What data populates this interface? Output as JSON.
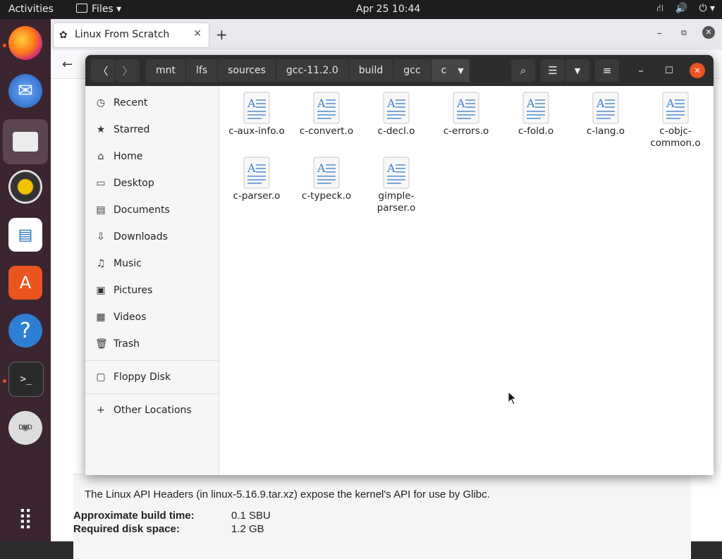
{
  "topbar": {
    "activities": "Activities",
    "app_menu": "Files",
    "clock": "Apr 25  10:44"
  },
  "browser": {
    "tab_title": "Linux From Scratch",
    "page": {
      "description": "The Linux API Headers (in linux-5.16.9.tar.xz) expose the kernel's API for use by Glibc.",
      "build_time_label": "Approximate build time:",
      "build_time_value": "0.1 SBU",
      "disk_space_label": "Required disk space:",
      "disk_space_value": "1.2 GB"
    }
  },
  "files": {
    "breadcrumbs": [
      "mnt",
      "lfs",
      "sources",
      "gcc-11.2.0",
      "build",
      "gcc",
      "c"
    ],
    "sidebar": [
      {
        "label": "Recent",
        "icon": "clock-icon"
      },
      {
        "label": "Starred",
        "icon": "star-icon"
      },
      {
        "label": "Home",
        "icon": "home-icon"
      },
      {
        "label": "Desktop",
        "icon": "desktop-icon"
      },
      {
        "label": "Documents",
        "icon": "documents-icon"
      },
      {
        "label": "Downloads",
        "icon": "download-icon"
      },
      {
        "label": "Music",
        "icon": "music-icon"
      },
      {
        "label": "Pictures",
        "icon": "pictures-icon"
      },
      {
        "label": "Videos",
        "icon": "videos-icon"
      },
      {
        "label": "Trash",
        "icon": "trash-icon"
      },
      {
        "label": "Floppy Disk",
        "icon": "floppy-icon"
      },
      {
        "label": "Other Locations",
        "icon": "plus-icon"
      }
    ],
    "items": [
      {
        "name": "c-aux-info.o"
      },
      {
        "name": "c-convert.o"
      },
      {
        "name": "c-decl.o"
      },
      {
        "name": "c-errors.o"
      },
      {
        "name": "c-fold.o"
      },
      {
        "name": "c-lang.o"
      },
      {
        "name": "c-objc-\ncommon.o"
      },
      {
        "name": "c-parser.o"
      },
      {
        "name": "c-typeck.o"
      },
      {
        "name": "gimple-\nparser.o"
      }
    ]
  },
  "colors": {
    "accent": "#e95420",
    "header": "#2d2d2d",
    "dock": "#3a2530"
  }
}
